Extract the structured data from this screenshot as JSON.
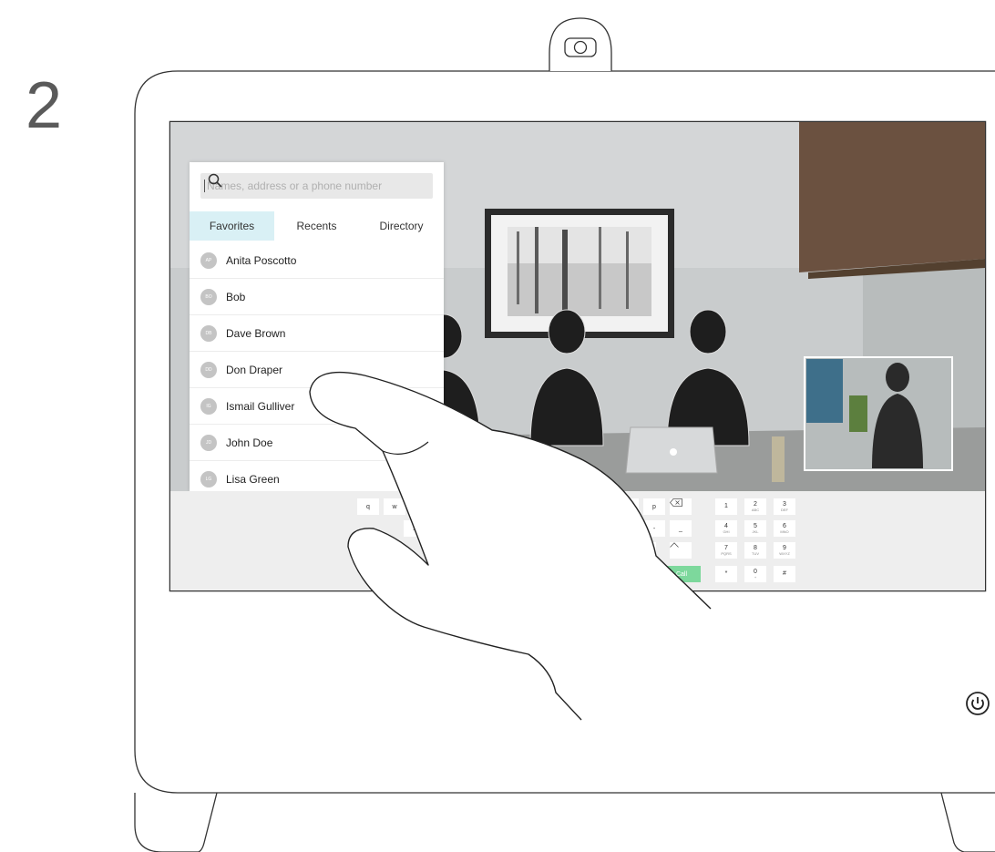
{
  "step_number": "2",
  "search": {
    "placeholder": "Names, address or a phone number"
  },
  "tabs": [
    {
      "label": "Favorites",
      "active": true
    },
    {
      "label": "Recents",
      "active": false
    },
    {
      "label": "Directory",
      "active": false
    }
  ],
  "contacts": [
    {
      "initials": "AP",
      "name": "Anita Poscotto"
    },
    {
      "initials": "BO",
      "name": "Bob"
    },
    {
      "initials": "DB",
      "name": "Dave Brown"
    },
    {
      "initials": "DD",
      "name": "Don Draper"
    },
    {
      "initials": "IG",
      "name": "Ismail Gulliver"
    },
    {
      "initials": "JD",
      "name": "John Doe"
    },
    {
      "initials": "LG",
      "name": "Lisa Green"
    }
  ],
  "keyboard": {
    "letters_row1": [
      "q",
      "w"
    ],
    "letters_row1_end": [
      "o",
      "p"
    ],
    "letters_row2": [
      "s"
    ],
    "letters_row2_end": [
      "l",
      "-",
      "_"
    ],
    "at_key": "@",
    "call_label": "Call",
    "dialpad": [
      {
        "digit": "1",
        "letters": ""
      },
      {
        "digit": "2",
        "letters": "ABC"
      },
      {
        "digit": "3",
        "letters": "DEF"
      },
      {
        "digit": "4",
        "letters": "GHI"
      },
      {
        "digit": "5",
        "letters": "JKL"
      },
      {
        "digit": "6",
        "letters": "MNO"
      },
      {
        "digit": "7",
        "letters": "PQRS"
      },
      {
        "digit": "8",
        "letters": "TUV"
      },
      {
        "digit": "9",
        "letters": "WXYZ"
      },
      {
        "digit": "*",
        "letters": ""
      },
      {
        "digit": "0",
        "letters": "+"
      },
      {
        "digit": "#",
        "letters": ""
      }
    ]
  },
  "icons": {
    "camera": "camera-icon",
    "search": "search-icon",
    "backspace": "backspace-icon",
    "caret_up": "caret-up-icon",
    "power": "power-icon"
  },
  "colors": {
    "tab_active": "#d9f0f5",
    "call_button": "#7dd89c"
  }
}
